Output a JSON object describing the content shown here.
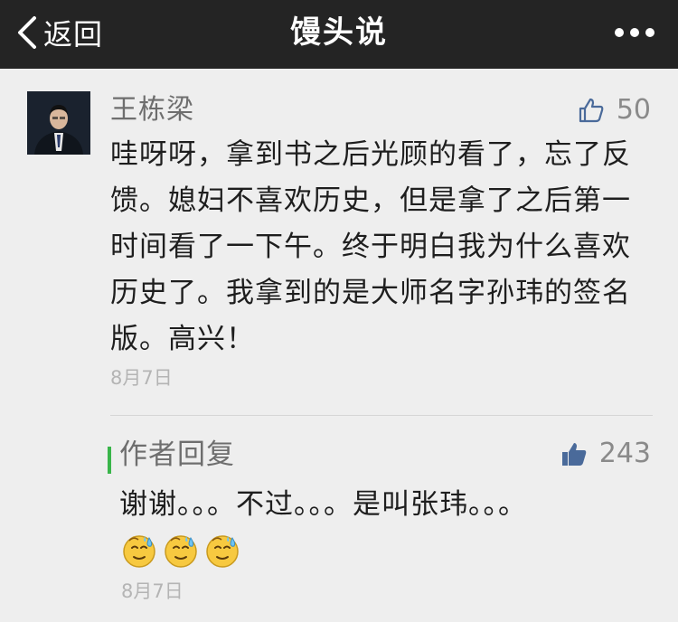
{
  "nav": {
    "back_label": "返回",
    "title": "馒头说",
    "more_icon": "more-dots-icon"
  },
  "comment": {
    "username": "王栋梁",
    "likes": "50",
    "text": "哇呀呀，拿到书之后光顾的看了，忘了反馈。媳妇不喜欢历史，但是拿了之后第一时间看了一下午。终于明白我为什么喜欢历史了。我拿到的是大师名字孙玮的签名版。高兴！",
    "date": "8月7日"
  },
  "reply": {
    "label": "作者回复",
    "likes": "243",
    "text": "谢谢。。。不过。。。是叫张玮。。。",
    "emoji_icon": "sweat-emoji-icon",
    "emoji_count": 3,
    "date": "8月7日"
  },
  "colors": {
    "navbar": "#242424",
    "reply_accent": "#39b54a",
    "like_icon": "#4a6a9a"
  }
}
